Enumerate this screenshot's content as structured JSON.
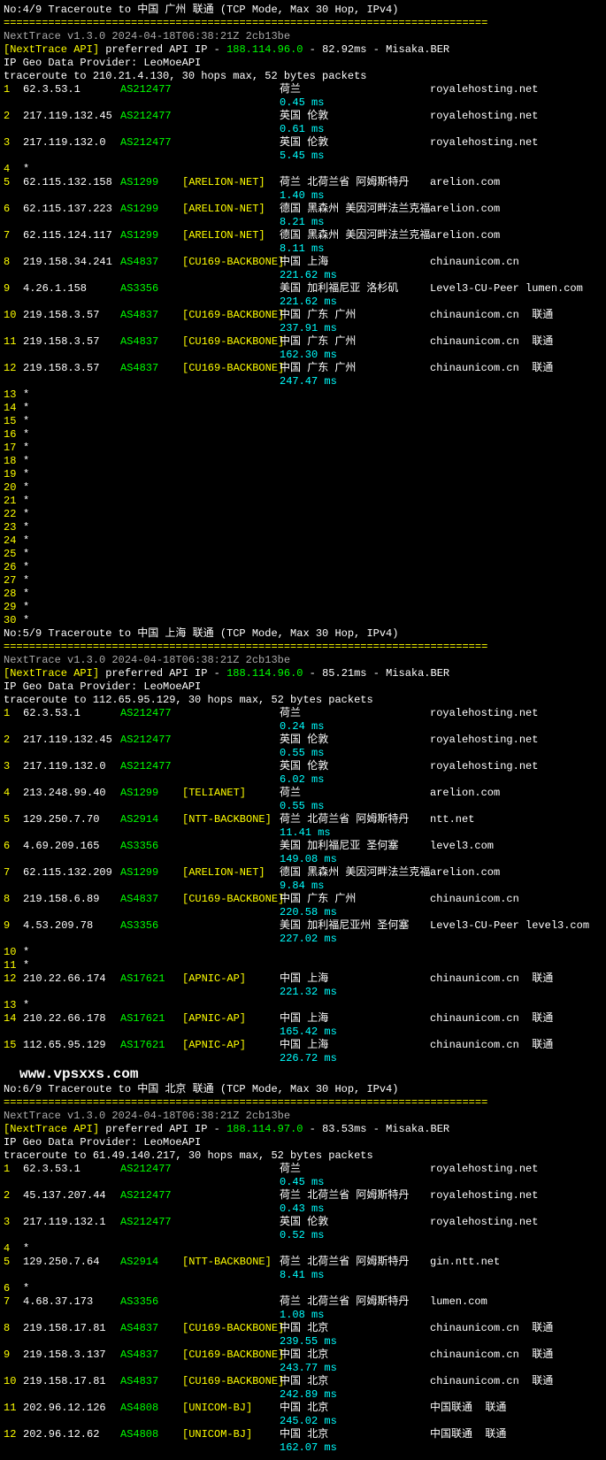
{
  "watermark": "www.vpsxxs.com",
  "blocks": [
    {
      "title": "No:4/9 Traceroute to 中国 广州 联通 (TCP Mode, Max 30 Hop, IPv4)",
      "nexttrace": "NextTrace v1.3.0 2024-04-18T06:38:21Z 2cb13be",
      "api_prefix": "[NextTrace API]",
      "api_text": " preferred API IP - ",
      "api_ip": "188.114.96.0",
      "api_rest": " - 82.92ms - Misaka.BER",
      "geo_provider": "IP Geo Data Provider: LeoMoeAPI",
      "trace_to": "traceroute to 210.21.4.130, 30 hops max, 52 bytes packets",
      "hops": [
        {
          "n": "1",
          "ip": "62.3.53.1",
          "asn": "AS212477",
          "net": "",
          "geo": "荷兰",
          "host": "royalehosting.net",
          "ms": "0.45 ms"
        },
        {
          "n": "2",
          "ip": "217.119.132.45",
          "asn": "AS212477",
          "net": "",
          "geo": "英国 伦敦",
          "host": "royalehosting.net",
          "ms": "0.61 ms"
        },
        {
          "n": "3",
          "ip": "217.119.132.0",
          "asn": "AS212477",
          "net": "",
          "geo": "英国 伦敦",
          "host": "royalehosting.net",
          "ms": "5.45 ms"
        },
        {
          "n": "4",
          "ip": "*"
        },
        {
          "n": "5",
          "ip": "62.115.132.158",
          "asn": "AS1299",
          "net": "[ARELION-NET]",
          "geo": "荷兰 北荷兰省 阿姆斯特丹",
          "host": "arelion.com",
          "ms": "1.40 ms"
        },
        {
          "n": "6",
          "ip": "62.115.137.223",
          "asn": "AS1299",
          "net": "[ARELION-NET]",
          "geo": "德国 黑森州 美因河畔法兰克福",
          "host": "arelion.com",
          "ms": "8.21 ms"
        },
        {
          "n": "7",
          "ip": "62.115.124.117",
          "asn": "AS1299",
          "net": "[ARELION-NET]",
          "geo": "德国 黑森州 美因河畔法兰克福",
          "host": "arelion.com",
          "ms": "8.11 ms"
        },
        {
          "n": "8",
          "ip": "219.158.34.241",
          "asn": "AS4837",
          "net": "[CU169-BACKBONE]",
          "geo": "中国 上海",
          "host": "chinaunicom.cn",
          "ms": "221.62 ms"
        },
        {
          "n": "9",
          "ip": "4.26.1.158",
          "asn": "AS3356",
          "net": "",
          "geo": "美国 加利福尼亚 洛杉矶",
          "host": "Level3-CU-Peer lumen.com",
          "ms": "221.62 ms"
        },
        {
          "n": "10",
          "ip": "219.158.3.57",
          "asn": "AS4837",
          "net": "[CU169-BACKBONE]",
          "geo": "中国 广东 广州",
          "host": "chinaunicom.cn  联通",
          "ms": "237.91 ms"
        },
        {
          "n": "11",
          "ip": "219.158.3.57",
          "asn": "AS4837",
          "net": "[CU169-BACKBONE]",
          "geo": "中国 广东 广州",
          "host": "chinaunicom.cn  联通",
          "ms": "162.30 ms"
        },
        {
          "n": "12",
          "ip": "219.158.3.57",
          "asn": "AS4837",
          "net": "[CU169-BACKBONE]",
          "geo": "中国 广东 广州",
          "host": "chinaunicom.cn  联通",
          "ms": "247.47 ms"
        },
        {
          "n": "13",
          "ip": "*"
        },
        {
          "n": "14",
          "ip": "*"
        },
        {
          "n": "15",
          "ip": "*"
        },
        {
          "n": "16",
          "ip": "*"
        },
        {
          "n": "17",
          "ip": "*"
        },
        {
          "n": "18",
          "ip": "*"
        },
        {
          "n": "19",
          "ip": "*"
        },
        {
          "n": "20",
          "ip": "*"
        },
        {
          "n": "21",
          "ip": "*"
        },
        {
          "n": "22",
          "ip": "*"
        },
        {
          "n": "23",
          "ip": "*"
        },
        {
          "n": "24",
          "ip": "*"
        },
        {
          "n": "25",
          "ip": "*"
        },
        {
          "n": "26",
          "ip": "*"
        },
        {
          "n": "27",
          "ip": "*"
        },
        {
          "n": "28",
          "ip": "*"
        },
        {
          "n": "29",
          "ip": "*"
        },
        {
          "n": "30",
          "ip": "*"
        }
      ]
    },
    {
      "title": "No:5/9 Traceroute to 中国 上海 联通 (TCP Mode, Max 30 Hop, IPv4)",
      "nexttrace": "NextTrace v1.3.0 2024-04-18T06:38:21Z 2cb13be",
      "api_prefix": "[NextTrace API]",
      "api_text": " preferred API IP - ",
      "api_ip": "188.114.96.0",
      "api_rest": " - 85.21ms - Misaka.BER",
      "geo_provider": "IP Geo Data Provider: LeoMoeAPI",
      "trace_to": "traceroute to 112.65.95.129, 30 hops max, 52 bytes packets",
      "hops": [
        {
          "n": "1",
          "ip": "62.3.53.1",
          "asn": "AS212477",
          "net": "",
          "geo": "荷兰",
          "host": "royalehosting.net",
          "ms": "0.24 ms"
        },
        {
          "n": "2",
          "ip": "217.119.132.45",
          "asn": "AS212477",
          "net": "",
          "geo": "英国 伦敦",
          "host": "royalehosting.net",
          "ms": "0.55 ms"
        },
        {
          "n": "3",
          "ip": "217.119.132.0",
          "asn": "AS212477",
          "net": "",
          "geo": "英国 伦敦",
          "host": "royalehosting.net",
          "ms": "6.02 ms"
        },
        {
          "n": "4",
          "ip": "213.248.99.40",
          "asn": "AS1299",
          "net": "[TELIANET]",
          "geo": "荷兰",
          "host": "arelion.com",
          "ms": "0.55 ms"
        },
        {
          "n": "5",
          "ip": "129.250.7.70",
          "asn": "AS2914",
          "net": "[NTT-BACKBONE]",
          "geo": "荷兰 北荷兰省 阿姆斯特丹",
          "host": "ntt.net",
          "ms": "11.41 ms"
        },
        {
          "n": "6",
          "ip": "4.69.209.165",
          "asn": "AS3356",
          "net": "",
          "geo": "美国 加利福尼亚 圣何塞",
          "host": "level3.com",
          "ms": "149.08 ms"
        },
        {
          "n": "7",
          "ip": "62.115.132.209",
          "asn": "AS1299",
          "net": "[ARELION-NET]",
          "geo": "德国 黑森州 美因河畔法兰克福",
          "host": "arelion.com",
          "ms": "9.84 ms"
        },
        {
          "n": "8",
          "ip": "219.158.6.89",
          "asn": "AS4837",
          "net": "[CU169-BACKBONE]",
          "geo": "中国 广东 广州",
          "host": "chinaunicom.cn",
          "ms": "220.58 ms"
        },
        {
          "n": "9",
          "ip": "4.53.209.78",
          "asn": "AS3356",
          "net": "",
          "geo": "美国 加利福尼亚州 圣何塞",
          "host": "Level3-CU-Peer level3.com",
          "ms": "227.02 ms"
        },
        {
          "n": "10",
          "ip": "*"
        },
        {
          "n": "11",
          "ip": "*"
        },
        {
          "n": "12",
          "ip": "210.22.66.174",
          "asn": "AS17621",
          "net": "[APNIC-AP]",
          "geo": "中国 上海",
          "host": "chinaunicom.cn  联通",
          "ms": "221.32 ms"
        },
        {
          "n": "13",
          "ip": "*"
        },
        {
          "n": "14",
          "ip": "210.22.66.178",
          "asn": "AS17621",
          "net": "[APNIC-AP]",
          "geo": "中国 上海",
          "host": "chinaunicom.cn  联通",
          "ms": "165.42 ms"
        },
        {
          "n": "15",
          "ip": "112.65.95.129",
          "asn": "AS17621",
          "net": "[APNIC-AP]",
          "geo": "中国 上海",
          "host": "chinaunicom.cn  联通",
          "ms": "226.72 ms"
        }
      ],
      "watermark_after": true
    },
    {
      "title": "No:6/9 Traceroute to 中国 北京 联通 (TCP Mode, Max 30 Hop, IPv4)",
      "nexttrace": "NextTrace v1.3.0 2024-04-18T06:38:21Z 2cb13be",
      "api_prefix": "[NextTrace API]",
      "api_text": " preferred API IP - ",
      "api_ip": "188.114.97.0",
      "api_rest": " - 83.53ms - Misaka.BER",
      "geo_provider": "IP Geo Data Provider: LeoMoeAPI",
      "trace_to": "traceroute to 61.49.140.217, 30 hops max, 52 bytes packets",
      "hops": [
        {
          "n": "1",
          "ip": "62.3.53.1",
          "asn": "AS212477",
          "net": "",
          "geo": "荷兰",
          "host": "royalehosting.net",
          "ms": "0.45 ms"
        },
        {
          "n": "2",
          "ip": "45.137.207.44",
          "asn": "AS212477",
          "net": "",
          "geo": "荷兰 北荷兰省 阿姆斯特丹",
          "host": "royalehosting.net",
          "ms": "0.43 ms"
        },
        {
          "n": "3",
          "ip": "217.119.132.1",
          "asn": "AS212477",
          "net": "",
          "geo": "英国 伦敦",
          "host": "royalehosting.net",
          "ms": "0.52 ms"
        },
        {
          "n": "4",
          "ip": "*"
        },
        {
          "n": "5",
          "ip": "129.250.7.64",
          "asn": "AS2914",
          "net": "[NTT-BACKBONE]",
          "geo": "荷兰 北荷兰省 阿姆斯特丹",
          "host": "gin.ntt.net",
          "ms": "8.41 ms"
        },
        {
          "n": "6",
          "ip": "*"
        },
        {
          "n": "7",
          "ip": "4.68.37.173",
          "asn": "AS3356",
          "net": "",
          "geo": "荷兰 北荷兰省 阿姆斯特丹",
          "host": "lumen.com",
          "ms": "1.08 ms"
        },
        {
          "n": "8",
          "ip": "219.158.17.81",
          "asn": "AS4837",
          "net": "[CU169-BACKBONE]",
          "geo": "中国 北京",
          "host": "chinaunicom.cn  联通",
          "ms": "239.55 ms"
        },
        {
          "n": "9",
          "ip": "219.158.3.137",
          "asn": "AS4837",
          "net": "[CU169-BACKBONE]",
          "geo": "中国 北京",
          "host": "chinaunicom.cn  联通",
          "ms": "243.77 ms"
        },
        {
          "n": "10",
          "ip": "219.158.17.81",
          "asn": "AS4837",
          "net": "[CU169-BACKBONE]",
          "geo": "中国 北京",
          "host": "chinaunicom.cn  联通",
          "ms": "242.89 ms"
        },
        {
          "n": "11",
          "ip": "202.96.12.126",
          "asn": "AS4808",
          "net": "[UNICOM-BJ]",
          "geo": "中国 北京",
          "host": "中国联通  联通",
          "ms": "245.02 ms"
        },
        {
          "n": "12",
          "ip": "202.96.12.62",
          "asn": "AS4808",
          "net": "[UNICOM-BJ]",
          "geo": "中国 北京",
          "host": "中国联通  联通",
          "ms": "162.07 ms"
        }
      ]
    }
  ],
  "separator": "============================================================================"
}
